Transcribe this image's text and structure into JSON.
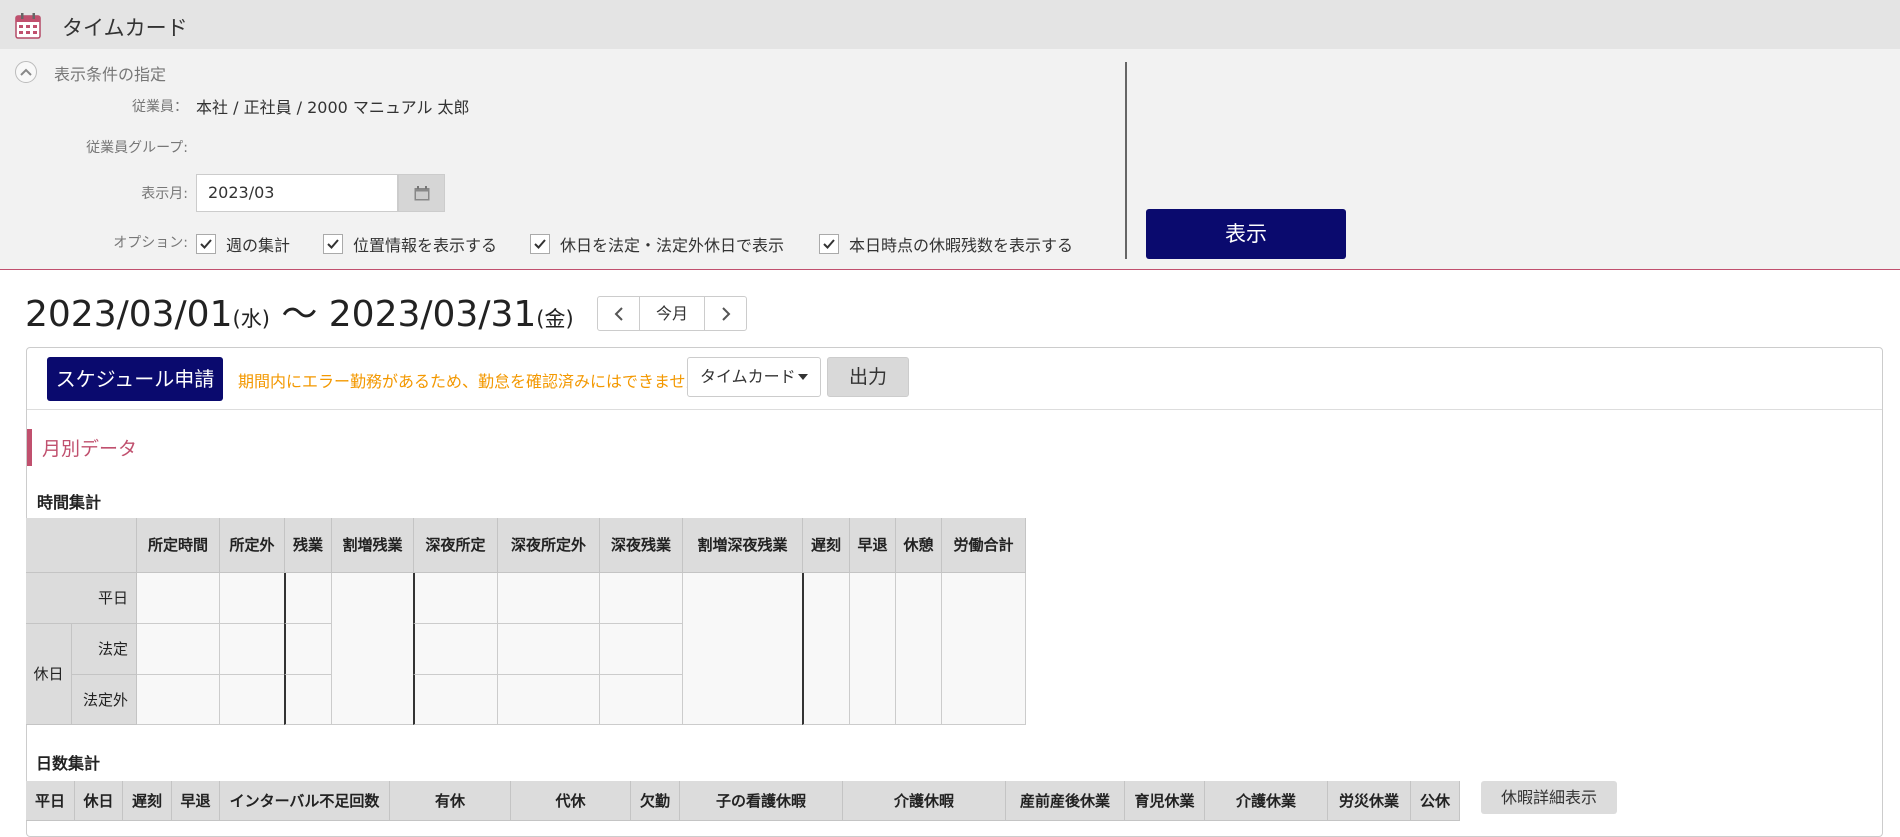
{
  "app": {
    "title": "タイムカード"
  },
  "conditions": {
    "title": "表示条件の指定",
    "employee_label": "従業員：",
    "employee_value": "本社 / 正社員 / 2000 マニュアル 太郎",
    "group_label": "従業員グループ:",
    "month_label": "表示月:",
    "month_value": "2023/03",
    "options_label": "オプション:",
    "options": [
      {
        "label": "週の集計",
        "checked": true
      },
      {
        "label": "位置情報を表示する",
        "checked": true
      },
      {
        "label": "休日を法定・法定外休日で表示",
        "checked": true
      },
      {
        "label": "本日時点の休暇残数を表示する",
        "checked": true
      }
    ],
    "show_button": "表示"
  },
  "period": {
    "start": "2023/03/01",
    "start_dow": "(水)",
    "sep": " 〜 ",
    "end": "2023/03/31",
    "end_dow": "(金)",
    "today_button": "今月"
  },
  "toolbar": {
    "schedule_button": "スケジュール申請",
    "warning": "期間内にエラー勤務があるため、勤怠を確認済みにはできません。",
    "format_select": "タイムカード",
    "output_button": "出力"
  },
  "monthly": {
    "title": "月別データ",
    "time_title": "時間集計",
    "time_headers": [
      "所定時間",
      "所定外",
      "残業",
      "割増残業",
      "深夜所定",
      "深夜所定外",
      "深夜残業",
      "割増深夜残業",
      "遅刻",
      "早退",
      "休憩",
      "労働合計"
    ],
    "row_weekday": "平日",
    "row_holiday": "休日",
    "row_legal": "法定",
    "row_nonlegal": "法定外",
    "days_title": "日数集計",
    "days_headers": [
      "平日",
      "休日",
      "遅刻",
      "早退",
      "インターバル不足回数",
      "有休",
      "代休",
      "欠勤",
      "子の看護休暇",
      "介護休暇",
      "産前産後休業",
      "育児休業",
      "介護休業",
      "労災休業",
      "公休"
    ],
    "leave_detail_button": "休暇詳細表示"
  },
  "colors": {
    "navy": "#0a0a6e",
    "accent": "#c0506e",
    "warning": "#f39800"
  }
}
